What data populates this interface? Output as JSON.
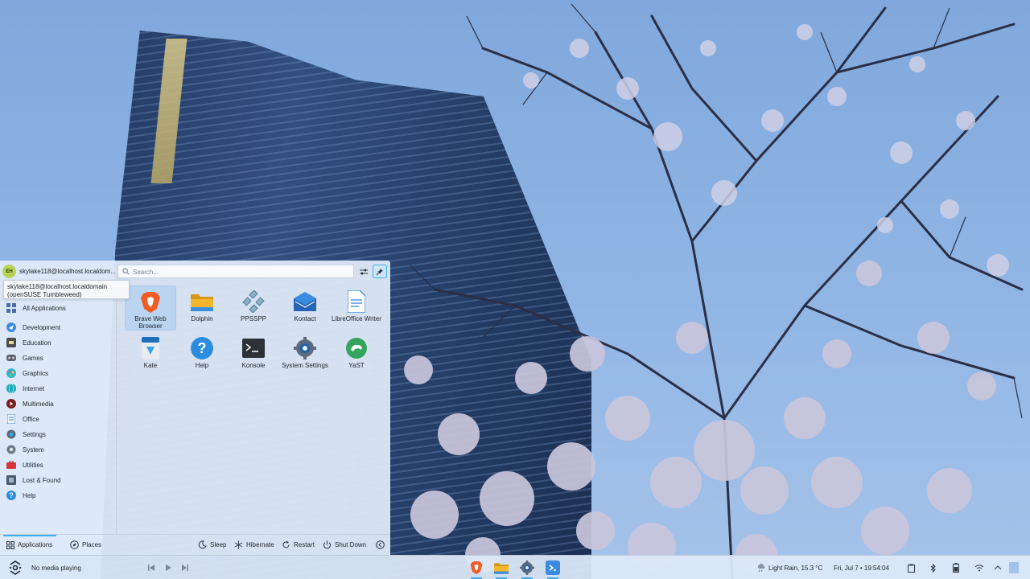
{
  "user": {
    "initials": "EH",
    "display_name": "skylake118@localhost.localdom...",
    "tooltip_line1": "skylake118@localhost.localdomain",
    "tooltip_line2": "(openSUSE Tumbleweed)"
  },
  "search": {
    "placeholder": "Search..."
  },
  "sidebar": {
    "items": [
      {
        "label": "All Applications",
        "icon": "grid-icon"
      },
      {
        "label": "Development",
        "icon": "development-icon"
      },
      {
        "label": "Education",
        "icon": "education-icon"
      },
      {
        "label": "Games",
        "icon": "gamepad-icon"
      },
      {
        "label": "Graphics",
        "icon": "graphics-icon"
      },
      {
        "label": "Internet",
        "icon": "globe-icon"
      },
      {
        "label": "Multimedia",
        "icon": "multimedia-icon"
      },
      {
        "label": "Office",
        "icon": "office-icon"
      },
      {
        "label": "Settings",
        "icon": "settings-icon"
      },
      {
        "label": "System",
        "icon": "system-icon"
      },
      {
        "label": "Utilities",
        "icon": "toolbox-icon"
      },
      {
        "label": "Lost & Found",
        "icon": "lost-found-icon"
      },
      {
        "label": "Help",
        "icon": "help-icon"
      }
    ]
  },
  "apps": [
    {
      "label": "Brave Web Browser",
      "icon": "brave-icon"
    },
    {
      "label": "Dolphin",
      "icon": "folder-icon"
    },
    {
      "label": "PPSSPP",
      "icon": "ppsspp-icon"
    },
    {
      "label": "Kontact",
      "icon": "kontact-icon"
    },
    {
      "label": "LibreOffice Writer",
      "icon": "writer-icon"
    },
    {
      "label": "Kate",
      "icon": "kate-icon"
    },
    {
      "label": "Help",
      "icon": "help-icon"
    },
    {
      "label": "Konsole",
      "icon": "terminal-icon"
    },
    {
      "label": "System Settings",
      "icon": "gear-icon"
    },
    {
      "label": "YaST",
      "icon": "yast-icon"
    }
  ],
  "footer": {
    "applications": "Applications",
    "places": "Places",
    "sleep": "Sleep",
    "hibernate": "Hibernate",
    "restart": "Restart",
    "shutdown": "Shut Down"
  },
  "taskbar": {
    "media_status": "No media playing",
    "weather": "Light Rain, 15.3 °C",
    "datetime": "Fri, Jul 7 • 19:54:04"
  },
  "colors": {
    "accent": "#3daee9",
    "launcher_bg": "#e2ecfa",
    "taskbar_bg": "#dce8f8"
  }
}
